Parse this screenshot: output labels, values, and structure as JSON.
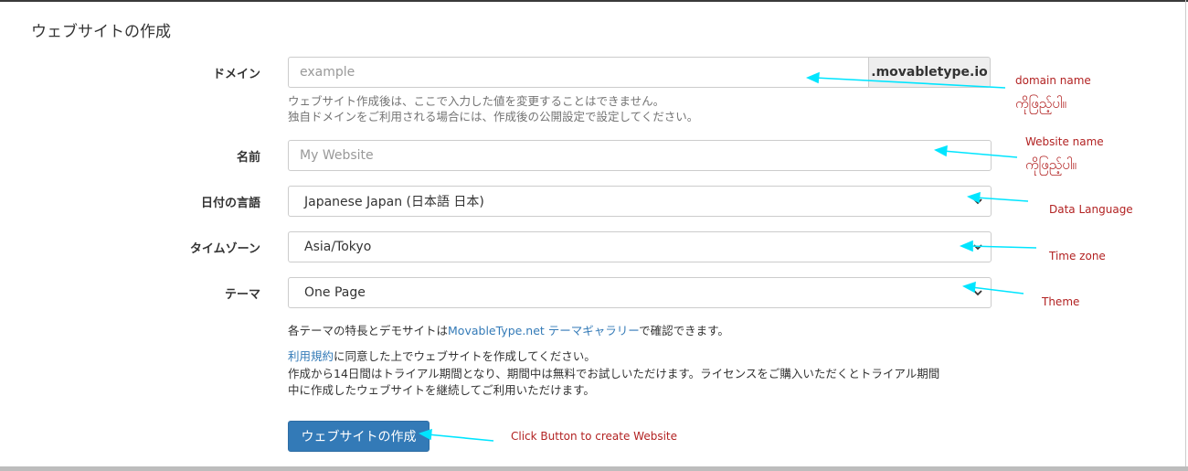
{
  "page": {
    "title": "ウェブサイトの作成"
  },
  "form": {
    "domain": {
      "label": "ドメイン",
      "placeholder": "example",
      "suffix": ".movabletype.io",
      "help_line1": "ウェブサイト作成後は、ここで入力した値を変更することはできません。",
      "help_line2": "独自ドメインをご利用される場合には、作成後の公開設定で設定してください。"
    },
    "name": {
      "label": "名前",
      "placeholder": "My Website"
    },
    "language": {
      "label": "日付の言語",
      "value": "Japanese Japan (日本語 日本)"
    },
    "timezone": {
      "label": "タイムゾーン",
      "value": "Asia/Tokyo"
    },
    "theme": {
      "label": "テーマ",
      "value": "One Page"
    },
    "theme_note": {
      "prefix": "各テーマの特長とデモサイトは",
      "link1": "MovableType.net",
      "space": " ",
      "link2": "テーマギャラリー",
      "suffix": "で確認できます。"
    },
    "terms": {
      "link": "利用規約",
      "line1_rest": "に同意した上でウェブサイトを作成してください。",
      "line2": "作成から14日間はトライアル期間となり、期間中は無料でお試しいただけます。ライセンスをご購入いただくとトライアル期間",
      "line3": "中に作成したウェブサイトを継続してご利用いただけます。"
    },
    "submit_label": "ウェブサイトの作成"
  },
  "annotations": {
    "domain_name": "domain name",
    "domain_name_mm": "ကိုဖြည့်ပါ။",
    "website_name": "Website name",
    "website_name_mm": "ကိုဖြည့်ပါ။",
    "data_language": "Data Language",
    "time_zone": "Time zone",
    "theme": "Theme",
    "click_button": "Click Button to create Website"
  },
  "colors": {
    "annotation_text": "#b22222",
    "arrow": "#00e5ff",
    "primary_button": "#337ab7",
    "link": "#337ab7"
  }
}
